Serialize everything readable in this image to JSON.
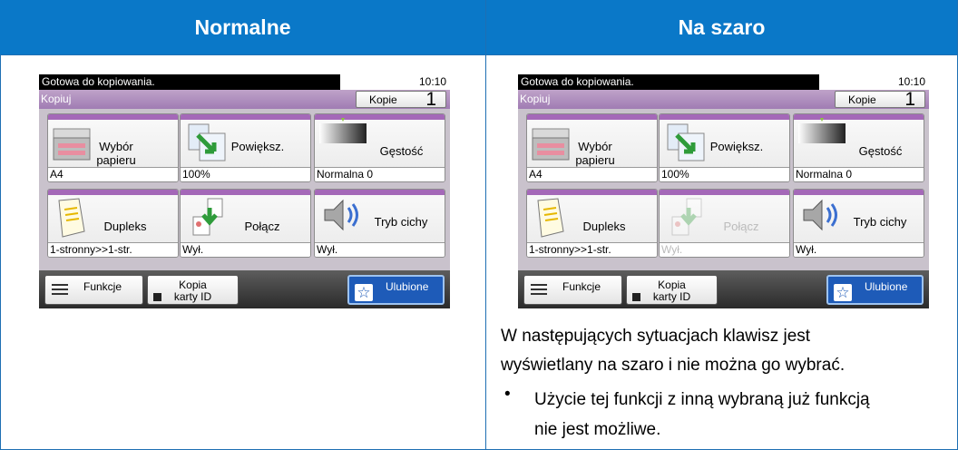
{
  "headers": {
    "left": "Normalne",
    "right": "Na szaro"
  },
  "panels": [
    {
      "status": "Gotowa do kopiowania.",
      "time": "10:10",
      "mode": "Kopiuj",
      "copies_label": "Kopie",
      "copies_value": "1",
      "tiles": [
        {
          "label": "Wybór papieru",
          "value": "A4",
          "icon": "paper-tray-icon",
          "disabled": false
        },
        {
          "label": "Powiększ.",
          "value": "100%",
          "icon": "zoom-icon",
          "disabled": false
        },
        {
          "label": "Gęstość",
          "value": "Normalna 0",
          "icon": "density-icon",
          "disabled": false
        },
        {
          "label": "Dupleks",
          "value": "1-stronny>>1-str.",
          "icon": "duplex-icon",
          "disabled": false
        },
        {
          "label": "Połącz",
          "value": "Wył.",
          "icon": "combine-icon",
          "disabled": false
        },
        {
          "label": "Tryb cichy",
          "value": "Wył.",
          "icon": "speaker-icon",
          "disabled": false
        }
      ],
      "buttons": {
        "functions": "Funkcje",
        "id_copy_line1": "Kopia",
        "id_copy_line2": "karty ID",
        "favorites": "Ulubione"
      }
    },
    {
      "status": "Gotowa do kopiowania.",
      "time": "10:10",
      "mode": "Kopiuj",
      "copies_label": "Kopie",
      "copies_value": "1",
      "tiles": [
        {
          "label": "Wybór papieru",
          "value": "A4",
          "icon": "paper-tray-icon",
          "disabled": false
        },
        {
          "label": "Powiększ.",
          "value": "100%",
          "icon": "zoom-icon",
          "disabled": false
        },
        {
          "label": "Gęstość",
          "value": "Normalna 0",
          "icon": "density-icon",
          "disabled": false
        },
        {
          "label": "Dupleks",
          "value": "1-stronny>>1-str.",
          "icon": "duplex-icon",
          "disabled": false
        },
        {
          "label": "Połącz",
          "value": "Wył.",
          "icon": "combine-icon",
          "disabled": true
        },
        {
          "label": "Tryb cichy",
          "value": "Wył.",
          "icon": "speaker-icon",
          "disabled": false
        }
      ],
      "buttons": {
        "functions": "Funkcje",
        "id_copy_line1": "Kopia",
        "id_copy_line2": "karty ID",
        "favorites": "Ulubione"
      }
    }
  ],
  "description": {
    "line1": "W następujących sytuacjach klawisz jest",
    "line2": "wyświetlany na szaro i nie można go wybrać.",
    "bullet": "•",
    "bullet_line1": "Użycie tej funkcji z inną wybraną już funkcją",
    "bullet_line2": "nie jest możliwe."
  },
  "colors": {
    "header": "#0a78c8",
    "accent_purple": "#a468b8",
    "favorites_blue": "#1e5bb8"
  }
}
